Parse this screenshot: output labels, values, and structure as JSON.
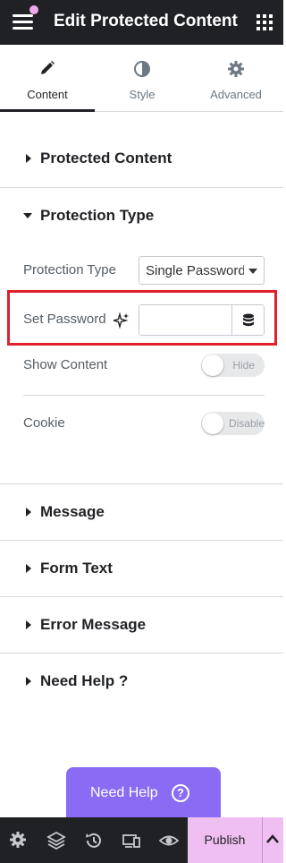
{
  "header": {
    "title": "Edit Protected Content"
  },
  "tabs": [
    {
      "label": "Content",
      "icon": "pencil-icon",
      "active": true
    },
    {
      "label": "Style",
      "icon": "contrast-icon",
      "active": false
    },
    {
      "label": "Advanced",
      "icon": "gear-icon",
      "active": false
    }
  ],
  "sections": {
    "protected_content": "Protected Content",
    "protection_type": "Protection Type",
    "message": "Message",
    "form_text": "Form Text",
    "error_message": "Error Message",
    "need_help": "Need Help ?"
  },
  "fields": {
    "protection_type_label": "Protection Type",
    "protection_type_value": "Single Password",
    "set_password_label": "Set Password",
    "set_password_value": "",
    "show_content_label": "Show Content",
    "show_content_toggle": "Hide",
    "cookie_label": "Cookie",
    "cookie_toggle": "Disable"
  },
  "need_help_button": {
    "label": "Need Help",
    "icon": "?"
  },
  "bottom_bar": {
    "icons": [
      "settings-icon",
      "layers-icon",
      "history-icon",
      "responsive-icon",
      "preview-icon"
    ],
    "publish_label": "Publish"
  },
  "colors": {
    "header_bg": "#1f2124",
    "accent_purple": "#8a6cf4",
    "publish_pink": "#f0bff2",
    "highlight_red": "#e0202b"
  }
}
